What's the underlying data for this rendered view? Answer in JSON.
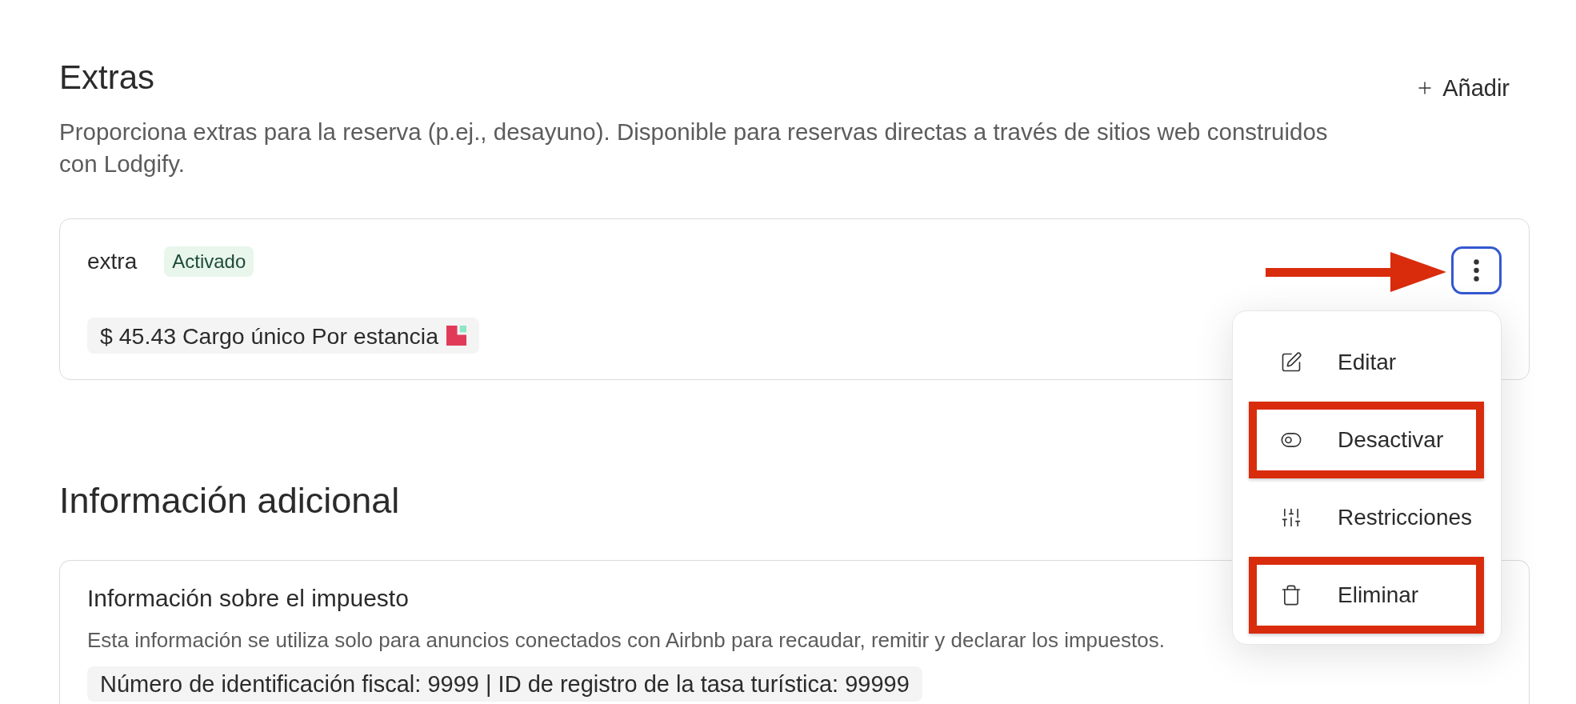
{
  "extras": {
    "title": "Extras",
    "add_button": "Añadir",
    "description": "Proporciona extras para la reserva (p.ej., desayuno). Disponible para reservas directas a través de sitios web construidos con Lodgify.",
    "items": [
      {
        "name": "extra",
        "status": "Activado",
        "price": "$ 45.43 Cargo único Por estancia",
        "menu_button": {
          "focused": true
        },
        "menu": {
          "open": true,
          "items": [
            {
              "kind": "edit",
              "label": "Editar",
              "highlighted": false
            },
            {
              "kind": "toggle",
              "label": "Desactivar",
              "highlighted": true
            },
            {
              "kind": "sliders",
              "label": "Restricciones",
              "highlighted": false
            },
            {
              "kind": "trash",
              "label": "Eliminar",
              "highlighted": true
            }
          ]
        }
      }
    ]
  },
  "additional_info": {
    "title": "Información adicional",
    "tax": {
      "title": "Información sobre el impuesto",
      "description": "Esta información se utiliza solo para anuncios conectados con Airbnb para recaudar, remitir y declarar los impuestos.",
      "details": "Número de identificación fiscal: 9999 | ID de registro de la tasa turística: 99999"
    }
  }
}
